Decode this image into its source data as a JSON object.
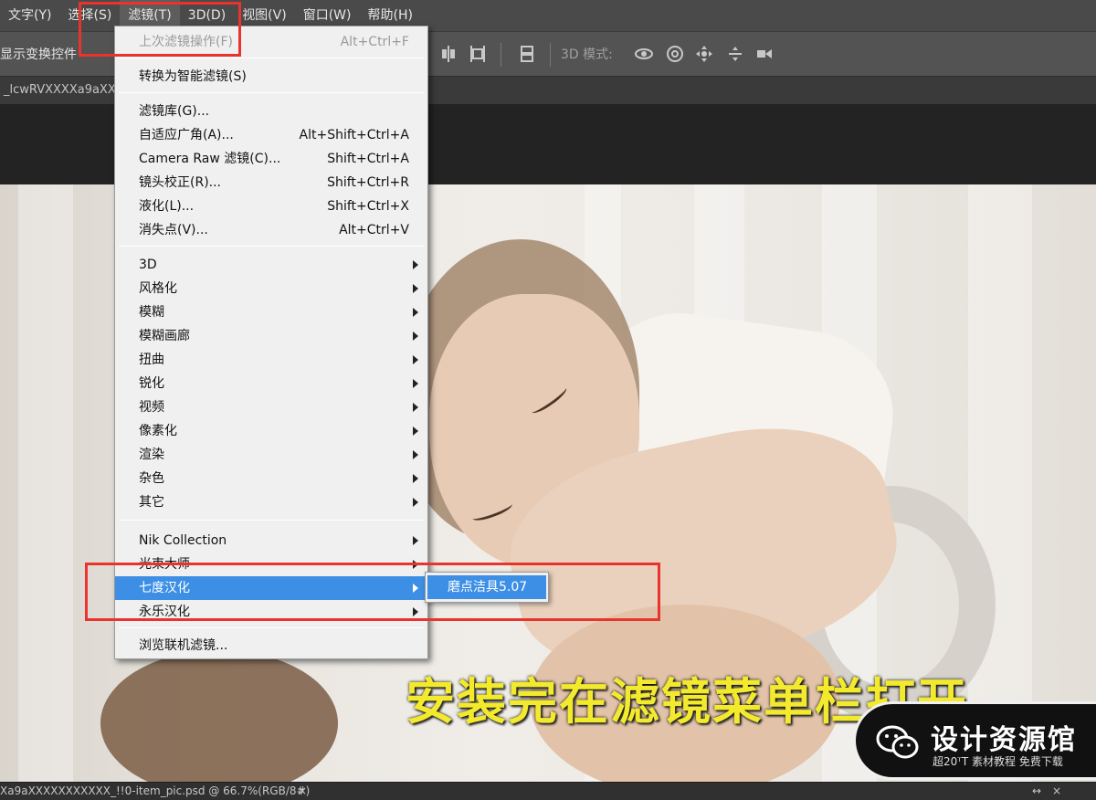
{
  "menubar": {
    "items": [
      {
        "label": "文字(Y)"
      },
      {
        "label": "选择(S)"
      },
      {
        "label": "滤镜(T)"
      },
      {
        "label": "3D(D)"
      },
      {
        "label": "视图(V)"
      },
      {
        "label": "窗口(W)"
      },
      {
        "label": "帮助(H)"
      }
    ]
  },
  "optionsbar": {
    "show_transform_label": "显示变换控件",
    "mode_label": "3D 模式:",
    "icons": [
      "align-center-icon",
      "distribute-icon",
      "auto-align-icon",
      "orbit-3d-icon",
      "roll-3d-icon",
      "drag-3d-icon",
      "slide-3d-icon",
      "zoom-3d-icon"
    ]
  },
  "document": {
    "tab_title": "_lcwRVXXXXa9aXX"
  },
  "filter_menu": {
    "last_filter": {
      "label": "上次滤镜操作(F)",
      "shortcut": "Alt+Ctrl+F"
    },
    "convert_smart": {
      "label": "转换为智能滤镜(S)"
    },
    "group_tools": [
      {
        "label": "滤镜库(G)...",
        "shortcut": ""
      },
      {
        "label": "自适应广角(A)...",
        "shortcut": "Alt+Shift+Ctrl+A"
      },
      {
        "label": "Camera Raw 滤镜(C)...",
        "shortcut": "Shift+Ctrl+A"
      },
      {
        "label": "镜头校正(R)...",
        "shortcut": "Shift+Ctrl+R"
      },
      {
        "label": "液化(L)...",
        "shortcut": "Shift+Ctrl+X"
      },
      {
        "label": "消失点(V)...",
        "shortcut": "Alt+Ctrl+V"
      }
    ],
    "group_submenus": [
      {
        "label": "3D"
      },
      {
        "label": "风格化"
      },
      {
        "label": "模糊"
      },
      {
        "label": "模糊画廊"
      },
      {
        "label": "扭曲"
      },
      {
        "label": "锐化"
      },
      {
        "label": "视频"
      },
      {
        "label": "像素化"
      },
      {
        "label": "渲染"
      },
      {
        "label": "杂色"
      },
      {
        "label": "其它"
      }
    ],
    "group_plugins": [
      {
        "label": "Nik Collection"
      },
      {
        "label": "光束大师"
      },
      {
        "label": "七度汉化"
      },
      {
        "label": "永乐汉化"
      }
    ],
    "browse_online": {
      "label": "浏览联机滤镜..."
    }
  },
  "submenu": {
    "item": "磨点洁具5.07"
  },
  "caption": "安装完在滤镜菜单栏打开",
  "watermark": {
    "brand": "设计资源馆",
    "tagline": "超20ᵀT 素材教程 免费下载"
  },
  "statusbar": {
    "filename": "Xa9aXXXXXXXXXXX_!!0-item_pic.psd @ 66.7%(RGB/8#)",
    "close": "×",
    "right_controls": [
      "↔",
      "×"
    ]
  },
  "colors": {
    "menu_highlight": "#3d8fe6",
    "annotation_red": "#e8342c",
    "caption_yellow": "#f3ea2e"
  }
}
